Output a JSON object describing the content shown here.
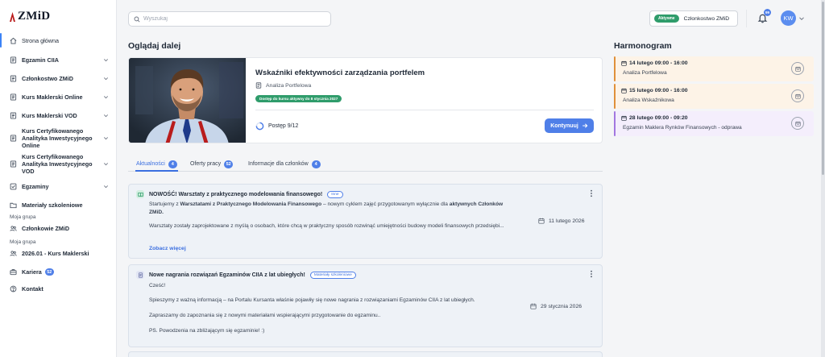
{
  "app": {
    "logo": "ZMiD"
  },
  "sidebar": {
    "items": [
      {
        "label": "Strona główna",
        "icon": "home-icon"
      },
      {
        "label": "Egzamin CIIA",
        "icon": "book-icon"
      },
      {
        "label": "Członkostwo ZMiD",
        "icon": "book-icon"
      },
      {
        "label": "Kurs Maklerski Online",
        "icon": "book-icon"
      },
      {
        "label": "Kurs Maklerski VOD",
        "icon": "book-icon"
      },
      {
        "label": "Kurs Certyfikowanego Analityka Inwestycyjnego Online",
        "icon": "book-icon"
      },
      {
        "label": "Kurs Certyfikowanego Analityka Inwestycyjnego VOD",
        "icon": "book-icon"
      },
      {
        "label": "Egzaminy",
        "icon": "check-square-icon"
      },
      {
        "label": "Materiały szkoleniowe",
        "icon": "folder-icon"
      },
      {
        "label": "Członkowie ZMiD",
        "icon": "users-icon"
      },
      {
        "label": "2026.01 - Kurs Maklerski",
        "icon": "users-icon"
      },
      {
        "label": "Kariera",
        "icon": "briefcase-icon",
        "badge": "52"
      },
      {
        "label": "Kontakt",
        "icon": "help-circle-icon"
      }
    ],
    "group_label_1": "Moja grupa",
    "group_label_2": "Moja grupa"
  },
  "header": {
    "search_placeholder": "Wyszukaj",
    "membership_status": "Aktywne",
    "membership_label": "Członkostwo ZMiD",
    "notifications_count": "99",
    "avatar_initials": "KW"
  },
  "continue": {
    "section_title": "Oglądaj dalej",
    "title": "Wskaźniki efektywności zarządzania portfelem",
    "category": "Analiza Portfelowa",
    "access": "Dostęp do kursu aktywny do 8 stycznia 2027",
    "progress_label": "Postęp 9/12",
    "progress_fraction": 0.75,
    "button_label": "Kontynuuj"
  },
  "tabs": [
    {
      "label": "Aktualności",
      "count": "4"
    },
    {
      "label": "Oferty pracy",
      "count": "52"
    },
    {
      "label": "Informacje dla członków",
      "count": "4"
    }
  ],
  "news": [
    {
      "title": "NOWOŚĆ! Warsztaty z praktycznego modelowania finansowego!",
      "tag": "Inne",
      "body_p1_a": "Startujemy z ",
      "body_p1_b": "Warsztatami z Praktycznego Modelowania Finansowego",
      "body_p1_c": " – nowym cyklem zajęć przygotowanym wyłącznie dla ",
      "body_p1_d": "aktywnych Członków ZMiD.",
      "body_p2": "Warsztaty zostały zaprojektowane z myślą o osobach, które chcą w praktyczny sposób rozwinąć umiejętności budowy modeli finansowych przedsiębi...",
      "date": "11 lutego 2026",
      "more": "Zobacz więcej"
    },
    {
      "title": "Nowe nagrania rozwiązań Egzaminów CIIA z lat ubiegłych!",
      "tag": "Materiały szkoleniowe",
      "greeting": "Cześć!",
      "body_p1": "Spieszymy z ważną informacją – na Portalu Kursanta właśnie pojawiły się nowe nagrania z rozwiązaniami Egzaminów CIIA z lat ubiegłych.",
      "body_p2": "Zapraszamy do zapoznania się z nowymi materiałami wspierającymi przygotowanie do egzaminu..",
      "body_p3": "PS. Powodzenia na zbliżającym się egzaminie! :)",
      "date": "29 stycznia 2026"
    }
  ],
  "schedule": {
    "title": "Harmonogram",
    "items": [
      {
        "time": "14 lutego 09:00 - 16:00",
        "name": "Analiza Portfelowa",
        "color": "#e0903a",
        "bg": "#fdf3e7"
      },
      {
        "time": "15 lutego 09:00 - 16:00",
        "name": "Analiza Wskaźnikowa",
        "color": "#e0903a",
        "bg": "#fdf3e7"
      },
      {
        "time": "28 lutego 09:00 - 09:20",
        "name": "Egzamin Maklera Rynków Finansowych - odprawa",
        "color": "#a277e0",
        "bg": "#f4eefc"
      }
    ]
  },
  "colors": {
    "accent": "#4f7fe8",
    "success": "#2f9c6b",
    "orange": "#e0903a",
    "purple": "#a277e0"
  }
}
